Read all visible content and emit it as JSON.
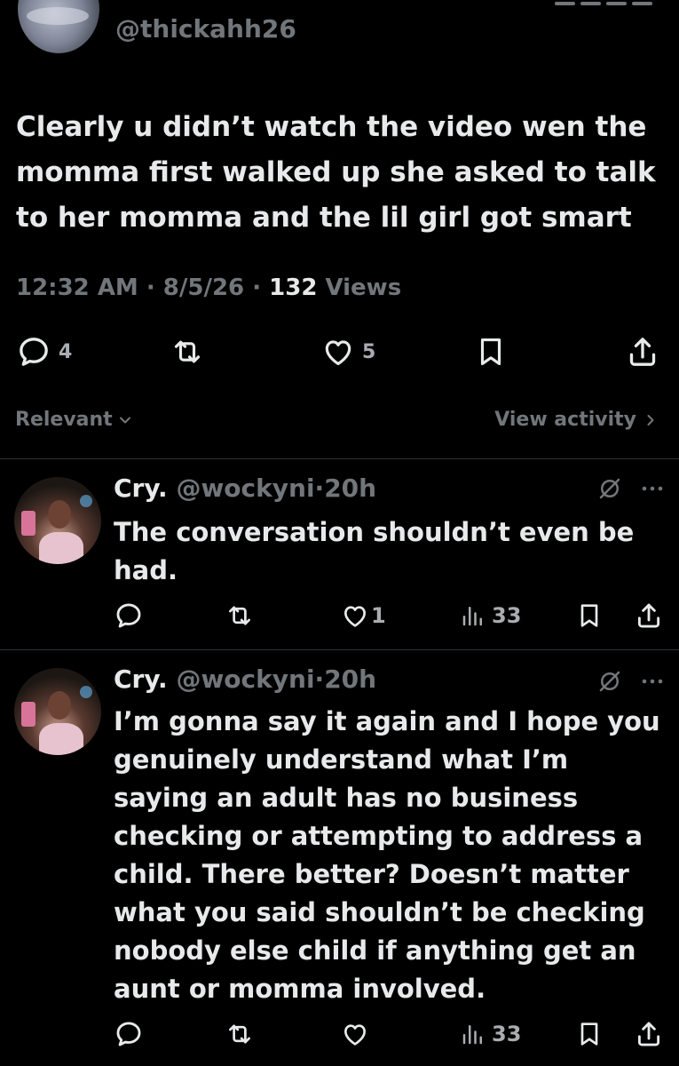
{
  "main_tweet": {
    "handle": "@thickahh26",
    "text": "Clearly u didn’t watch the video wen the momma first walked up she asked to talk to her momma and the lil girl got smart",
    "time": "12:32 AM",
    "sep1": " · ",
    "date": "8/5/26",
    "sep2": " · ",
    "views_count": "132",
    "views_label": " Views",
    "actions": {
      "reply_count": "4",
      "repost_icon": "repost-icon",
      "like_count": "5",
      "bookmark_icon": "bookmark-icon",
      "share_icon": "share-icon"
    }
  },
  "sort": {
    "relevant_label": "Relevant",
    "view_activity_label": "View activity"
  },
  "replies": [
    {
      "name": "Cry.",
      "handle": "@wockyni",
      "sep": "·",
      "time": "20h",
      "text": "The conversation shouldn’t even be had.",
      "like_count": "1",
      "views_count": "33"
    },
    {
      "name": "Cry.",
      "handle": "@wockyni",
      "sep": "·",
      "time": "20h",
      "text": "I’m gonna say it again and I hope you genuinely understand what I’m saying an adult has no business checking or attempting to address a child. There better? Doesn’t matter what you said shouldn’t be checking nobody else child if anything get an aunt or momma involved.",
      "like_count": "",
      "views_count": "33"
    }
  ],
  "colors": {
    "background": "#000000",
    "text": "#e7e9ea",
    "secondary": "#71767b",
    "divider": "#2f3336"
  }
}
